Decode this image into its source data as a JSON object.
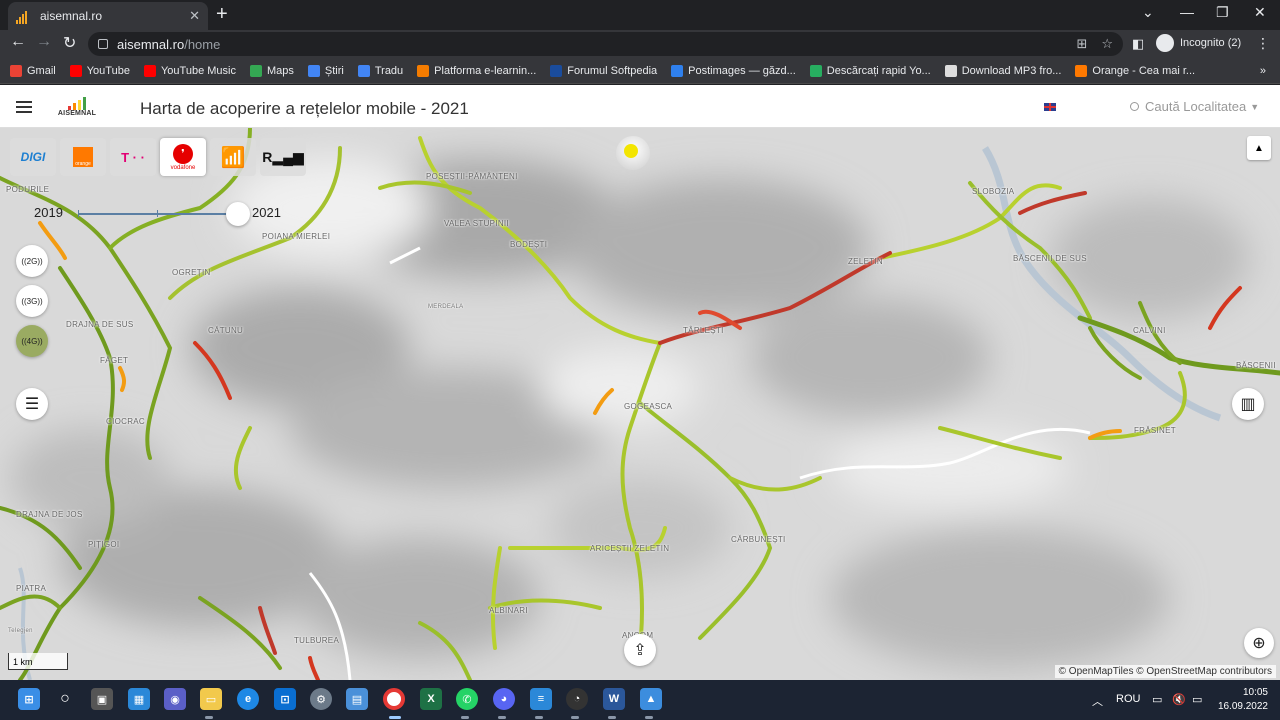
{
  "browser": {
    "tab_title": "aisemnal.ro",
    "url_host": "aisemnal.ro",
    "url_path": "/home",
    "incognito_label": "Incognito (2)",
    "bookmarks": [
      {
        "label": "Gmail",
        "icon": "gmail-icon",
        "color": "#ea4335"
      },
      {
        "label": "YouTube",
        "icon": "youtube-icon",
        "color": "#ff0000"
      },
      {
        "label": "YouTube Music",
        "icon": "youtube-music-icon",
        "color": "#ff0000"
      },
      {
        "label": "Maps",
        "icon": "maps-icon",
        "color": "#34a853"
      },
      {
        "label": "Știri",
        "icon": "news-icon",
        "color": "#4285f4"
      },
      {
        "label": "Tradu",
        "icon": "translate-icon",
        "color": "#4285f4"
      },
      {
        "label": "Platforma e-learnin...",
        "icon": "elearning-icon",
        "color": "#f57c00"
      },
      {
        "label": "Forumul Softpedia",
        "icon": "softpedia-icon",
        "color": "#1a4c9c"
      },
      {
        "label": "Postimages — găzd...",
        "icon": "postimages-icon",
        "color": "#2f80ed"
      },
      {
        "label": "Descărcați rapid Yo...",
        "icon": "download-icon",
        "color": "#27ae60"
      },
      {
        "label": "Download MP3 fro...",
        "icon": "mp3-icon",
        "color": "#dddddd"
      },
      {
        "label": "Orange - Cea mai r...",
        "icon": "orange-icon",
        "color": "#ff7900"
      }
    ]
  },
  "site": {
    "logo_text": "AISEMNAL",
    "title": "Harta de acoperire a rețelelor mobile - 2021",
    "search_placeholder": "Caută Localitatea"
  },
  "map": {
    "operators": [
      {
        "name": "digi",
        "label": "DIGI",
        "active": false
      },
      {
        "name": "orange",
        "label": "orange",
        "active": false
      },
      {
        "name": "telekom",
        "label": "T · ·",
        "active": false
      },
      {
        "name": "vodafone",
        "label": "vodafone",
        "active": true
      }
    ],
    "year_start": "2019",
    "year_end": "2021",
    "network_buttons": [
      "2G",
      "3G",
      "4G"
    ],
    "active_network": "4G",
    "scale_label": "1 km",
    "attribution": "© OpenMapTiles © OpenStreetMap contributors",
    "places": [
      "PODURILE",
      "POSEȘTII-PĂMÂNTENI",
      "VALEA STUPINII",
      "BODEȘTI",
      "POIANA MIERLEI",
      "OGREȚIN",
      "DRAJNA DE SUS",
      "CĂTUNU",
      "FĂGET",
      "CIOCRAC",
      "MERDEALA",
      "TÂRLEȘTI",
      "ZELETIN",
      "SLOBOZIA",
      "BĂSCENII DE SUS",
      "CALVINI",
      "BĂSCENII",
      "GOGEASCA",
      "FRĂSINET",
      "DRAJNA DE JOS",
      "PIȚIGOI",
      "ARICEȘTII ZELETIN",
      "CĂRBUNEȘTI",
      "ALBINARI",
      "PIATRA",
      "TULBUREA",
      "ANCOM",
      "Telegjen"
    ]
  },
  "taskbar": {
    "lang": "ROU",
    "time": "10:05",
    "date": "16.09.2022"
  }
}
